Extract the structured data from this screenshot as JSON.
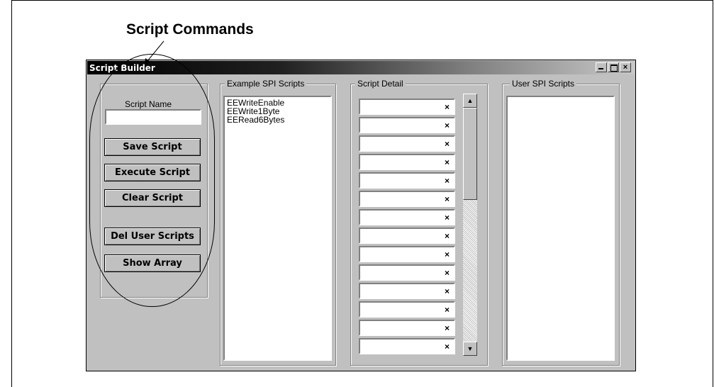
{
  "callout": {
    "title": "Script Commands"
  },
  "window": {
    "title": "Script Builder",
    "controls": {
      "minimize": "_",
      "maximize": "□",
      "close": "×"
    }
  },
  "commands": {
    "script_name_label": "Script Name",
    "script_name_value": "",
    "buttons": {
      "save": "Save Script",
      "execute": "Execute Script",
      "clear": "Clear Script",
      "del_user": "Del User Scripts",
      "show_array": "Show Array"
    }
  },
  "example_scripts": {
    "label": "Example SPI Scripts",
    "items": [
      "EEWriteEnable",
      "EEWrite1Byte",
      "EERead6Bytes"
    ]
  },
  "script_detail": {
    "label": "Script Detail",
    "rows": [
      "×",
      "×",
      "×",
      "×",
      "×",
      "×",
      "×",
      "×",
      "×",
      "×",
      "×",
      "×",
      "×",
      "×"
    ],
    "scroll_up": "▲",
    "scroll_down": "▼"
  },
  "user_scripts": {
    "label": "User SPI Scripts",
    "items": []
  }
}
